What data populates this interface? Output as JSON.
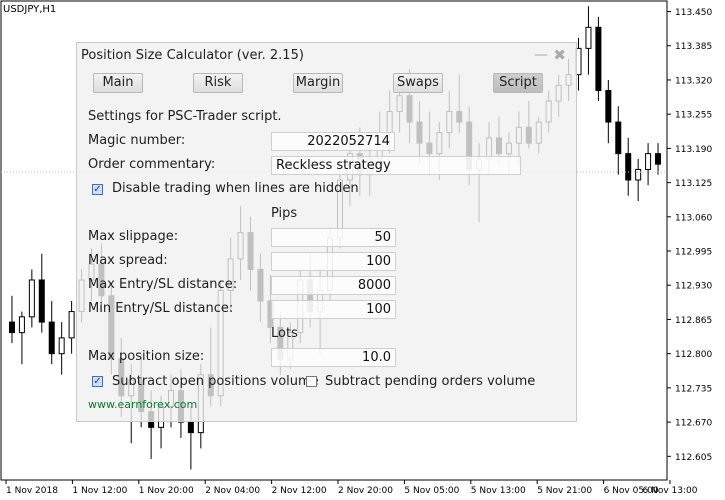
{
  "symbol": "USDJPY,H1",
  "panel": {
    "title": "Position Size Calculator (ver. 2.15)",
    "minimize_glyph": "—",
    "close_glyph": "✖",
    "tabs": [
      {
        "label": "Main",
        "active": false
      },
      {
        "label": "Risk",
        "active": false
      },
      {
        "label": "Margin",
        "active": false
      },
      {
        "label": "Swaps",
        "active": false
      },
      {
        "label": "Script",
        "active": true
      }
    ],
    "settings_heading": "Settings for PSC-Trader script.",
    "magic_label": "Magic number:",
    "magic_value": "2022052714",
    "commentary_label": "Order commentary:",
    "commentary_value": "Reckless strategy",
    "disable_trading": {
      "label": "Disable trading when lines are hidden",
      "checked": true
    },
    "pips_header": "Pips",
    "rows": [
      {
        "label": "Max slippage:",
        "value": "50"
      },
      {
        "label": "Max spread:",
        "value": "100"
      },
      {
        "label": "Max Entry/SL distance:",
        "value": "8000"
      },
      {
        "label": "Min Entry/SL distance:",
        "value": "100"
      }
    ],
    "lots_header": "Lots",
    "max_position_label": "Max position size:",
    "max_position_value": "10.0",
    "subtract_open": {
      "label": "Subtract open positions volume",
      "checked": true
    },
    "subtract_pending": {
      "label": "Subtract pending orders volume",
      "checked": false
    },
    "link": "www.earnforex.com"
  },
  "chart_data": {
    "type": "candlestick",
    "y_ticks": [
      "113.450",
      "113.385",
      "113.320",
      "113.255",
      "113.190",
      "113.125",
      "113.060",
      "112.995",
      "112.930",
      "112.865",
      "112.800",
      "112.735",
      "112.670",
      "112.605"
    ],
    "x_ticks": [
      "1 Nov 2018",
      "1 Nov 12:00",
      "1 Nov 20:00",
      "2 Nov 04:00",
      "2 Nov 12:00",
      "2 Nov 20:00",
      "5 Nov 05:00",
      "5 Nov 13:00",
      "5 Nov 21:00",
      "6 Nov 05:00",
      "6 Nov 13:00"
    ],
    "ylim": [
      112.56,
      113.47
    ],
    "current_price": 113.145,
    "candles": [
      [
        112.86,
        112.91,
        112.82,
        112.84
      ],
      [
        112.84,
        112.88,
        112.78,
        112.87
      ],
      [
        112.87,
        112.96,
        112.85,
        112.94
      ],
      [
        112.94,
        112.99,
        112.84,
        112.86
      ],
      [
        112.86,
        112.9,
        112.78,
        112.8
      ],
      [
        112.8,
        112.86,
        112.76,
        112.83
      ],
      [
        112.83,
        112.9,
        112.8,
        112.88
      ],
      [
        112.88,
        112.96,
        112.86,
        112.94
      ],
      [
        112.94,
        113.0,
        112.9,
        112.97
      ],
      [
        112.97,
        113.01,
        112.88,
        112.91
      ],
      [
        112.91,
        112.93,
        112.76,
        112.79
      ],
      [
        112.79,
        112.83,
        112.68,
        112.72
      ],
      [
        112.72,
        112.78,
        112.63,
        112.75
      ],
      [
        112.75,
        112.8,
        112.66,
        112.69
      ],
      [
        112.69,
        112.73,
        112.6,
        112.66
      ],
      [
        112.66,
        112.72,
        112.62,
        112.7
      ],
      [
        112.7,
        112.76,
        112.66,
        112.73
      ],
      [
        112.73,
        112.77,
        112.64,
        112.67
      ],
      [
        112.67,
        112.7,
        112.58,
        112.65
      ],
      [
        112.65,
        112.78,
        112.62,
        112.76
      ],
      [
        112.76,
        112.85,
        112.7,
        112.72
      ],
      [
        112.72,
        112.94,
        112.7,
        112.92
      ],
      [
        112.92,
        113.02,
        112.88,
        112.98
      ],
      [
        112.98,
        113.08,
        112.94,
        113.03
      ],
      [
        113.03,
        113.06,
        112.92,
        112.96
      ],
      [
        112.96,
        112.99,
        112.86,
        112.9
      ],
      [
        112.9,
        112.95,
        112.82,
        112.85
      ],
      [
        112.85,
        112.88,
        112.76,
        112.79
      ],
      [
        112.79,
        112.86,
        112.77,
        112.84
      ],
      [
        112.84,
        112.96,
        112.82,
        112.94
      ],
      [
        112.94,
        112.99,
        112.85,
        112.88
      ],
      [
        112.88,
        112.96,
        112.8,
        112.92
      ],
      [
        112.92,
        113.04,
        112.9,
        113.02
      ],
      [
        113.02,
        113.16,
        113.0,
        113.13
      ],
      [
        113.13,
        113.22,
        113.08,
        113.18
      ],
      [
        113.18,
        113.23,
        113.1,
        113.14
      ],
      [
        113.14,
        113.2,
        113.1,
        113.17
      ],
      [
        113.17,
        113.26,
        113.14,
        113.22
      ],
      [
        113.22,
        113.3,
        113.18,
        113.26
      ],
      [
        113.26,
        113.33,
        113.22,
        113.29
      ],
      [
        113.29,
        113.34,
        113.2,
        113.24
      ],
      [
        113.24,
        113.28,
        113.16,
        113.2
      ],
      [
        113.2,
        113.26,
        113.14,
        113.18
      ],
      [
        113.18,
        113.24,
        113.13,
        113.22
      ],
      [
        113.22,
        113.3,
        113.19,
        113.26
      ],
      [
        113.26,
        113.33,
        113.22,
        113.24
      ],
      [
        113.24,
        113.27,
        113.12,
        113.15
      ],
      [
        113.15,
        113.2,
        113.05,
        113.17
      ],
      [
        113.17,
        113.24,
        113.14,
        113.21
      ],
      [
        113.21,
        113.25,
        113.16,
        113.18
      ],
      [
        113.18,
        113.22,
        113.14,
        113.2
      ],
      [
        113.2,
        113.26,
        113.16,
        113.23
      ],
      [
        113.23,
        113.28,
        113.19,
        113.2
      ],
      [
        113.2,
        113.25,
        113.18,
        113.24
      ],
      [
        113.24,
        113.3,
        113.22,
        113.28
      ],
      [
        113.28,
        113.33,
        113.25,
        113.31
      ],
      [
        113.31,
        113.36,
        113.28,
        113.33
      ],
      [
        113.33,
        113.4,
        113.3,
        113.38
      ],
      [
        113.38,
        113.46,
        113.33,
        113.42
      ],
      [
        113.42,
        113.44,
        113.28,
        113.3
      ],
      [
        113.3,
        113.32,
        113.2,
        113.24
      ],
      [
        113.24,
        113.27,
        113.14,
        113.18
      ],
      [
        113.18,
        113.21,
        113.1,
        113.13
      ],
      [
        113.13,
        113.17,
        113.09,
        113.15
      ],
      [
        113.15,
        113.2,
        113.12,
        113.18
      ],
      [
        113.18,
        113.2,
        113.14,
        113.16
      ]
    ]
  }
}
